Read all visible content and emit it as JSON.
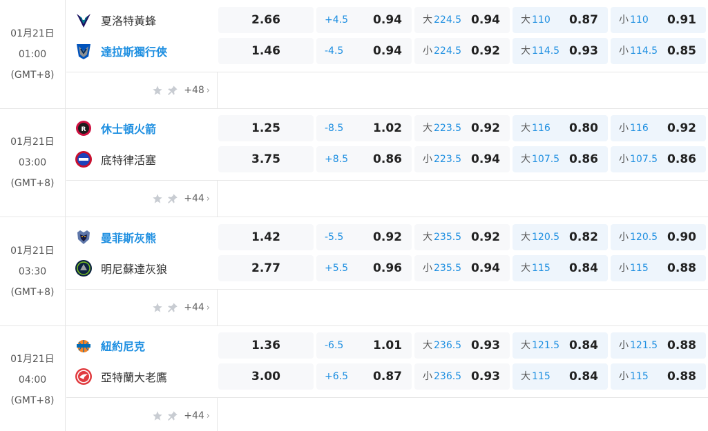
{
  "matches": [
    {
      "date": "01月21日",
      "time": "01:00",
      "timezone": "(GMT+8)",
      "home": {
        "name": "夏洛特黃蜂",
        "logo": "hornets-logo-icon",
        "fav": false,
        "moneyline": "2.66",
        "handicap": {
          "line": "+4.5",
          "odds": "0.94"
        },
        "total": {
          "prefix": "大",
          "line": "224.5",
          "odds": "0.94"
        },
        "team_total_1": {
          "prefix": "大",
          "line": "110",
          "odds": "0.87"
        },
        "team_total_2": {
          "prefix": "小",
          "line": "110",
          "odds": "0.91"
        }
      },
      "away": {
        "name": "達拉斯獨行俠",
        "logo": "mavericks-logo-icon",
        "fav": true,
        "moneyline": "1.46",
        "handicap": {
          "line": "-4.5",
          "odds": "0.94"
        },
        "total": {
          "prefix": "小",
          "line": "224.5",
          "odds": "0.92"
        },
        "team_total_1": {
          "prefix": "大",
          "line": "114.5",
          "odds": "0.93"
        },
        "team_total_2": {
          "prefix": "小",
          "line": "114.5",
          "odds": "0.85"
        }
      },
      "more": "+48"
    },
    {
      "date": "01月21日",
      "time": "03:00",
      "timezone": "(GMT+8)",
      "home": {
        "name": "休士頓火箭",
        "logo": "rockets-logo-icon",
        "fav": true,
        "moneyline": "1.25",
        "handicap": {
          "line": "-8.5",
          "odds": "1.02"
        },
        "total": {
          "prefix": "大",
          "line": "223.5",
          "odds": "0.92"
        },
        "team_total_1": {
          "prefix": "大",
          "line": "116",
          "odds": "0.80"
        },
        "team_total_2": {
          "prefix": "小",
          "line": "116",
          "odds": "0.92"
        }
      },
      "away": {
        "name": "底特律活塞",
        "logo": "pistons-logo-icon",
        "fav": false,
        "moneyline": "3.75",
        "handicap": {
          "line": "+8.5",
          "odds": "0.86"
        },
        "total": {
          "prefix": "小",
          "line": "223.5",
          "odds": "0.94"
        },
        "team_total_1": {
          "prefix": "大",
          "line": "107.5",
          "odds": "0.86"
        },
        "team_total_2": {
          "prefix": "小",
          "line": "107.5",
          "odds": "0.86"
        }
      },
      "more": "+44"
    },
    {
      "date": "01月21日",
      "time": "03:30",
      "timezone": "(GMT+8)",
      "home": {
        "name": "曼菲斯灰熊",
        "logo": "grizzlies-logo-icon",
        "fav": true,
        "moneyline": "1.42",
        "handicap": {
          "line": "-5.5",
          "odds": "0.92"
        },
        "total": {
          "prefix": "大",
          "line": "235.5",
          "odds": "0.92"
        },
        "team_total_1": {
          "prefix": "大",
          "line": "120.5",
          "odds": "0.82"
        },
        "team_total_2": {
          "prefix": "小",
          "line": "120.5",
          "odds": "0.90"
        }
      },
      "away": {
        "name": "明尼蘇達灰狼",
        "logo": "timberwolves-logo-icon",
        "fav": false,
        "moneyline": "2.77",
        "handicap": {
          "line": "+5.5",
          "odds": "0.96"
        },
        "total": {
          "prefix": "小",
          "line": "235.5",
          "odds": "0.94"
        },
        "team_total_1": {
          "prefix": "大",
          "line": "115",
          "odds": "0.84"
        },
        "team_total_2": {
          "prefix": "小",
          "line": "115",
          "odds": "0.88"
        }
      },
      "more": "+44"
    },
    {
      "date": "01月21日",
      "time": "04:00",
      "timezone": "(GMT+8)",
      "home": {
        "name": "紐約尼克",
        "logo": "knicks-logo-icon",
        "fav": true,
        "moneyline": "1.36",
        "handicap": {
          "line": "-6.5",
          "odds": "1.01"
        },
        "total": {
          "prefix": "大",
          "line": "236.5",
          "odds": "0.93"
        },
        "team_total_1": {
          "prefix": "大",
          "line": "121.5",
          "odds": "0.84"
        },
        "team_total_2": {
          "prefix": "小",
          "line": "121.5",
          "odds": "0.88"
        }
      },
      "away": {
        "name": "亞特蘭大老鷹",
        "logo": "hawks-logo-icon",
        "fav": false,
        "moneyline": "3.00",
        "handicap": {
          "line": "+6.5",
          "odds": "0.87"
        },
        "total": {
          "prefix": "小",
          "line": "236.5",
          "odds": "0.93"
        },
        "team_total_1": {
          "prefix": "大",
          "line": "115",
          "odds": "0.84"
        },
        "team_total_2": {
          "prefix": "小",
          "line": "115",
          "odds": "0.88"
        }
      },
      "more": "+44"
    }
  ],
  "colors": {
    "accent": "#1e8fe1",
    "cell_bg": "#f7f8fa",
    "cell_highlight_bg": "#eef5fc",
    "divider": "#e6e6e6"
  }
}
